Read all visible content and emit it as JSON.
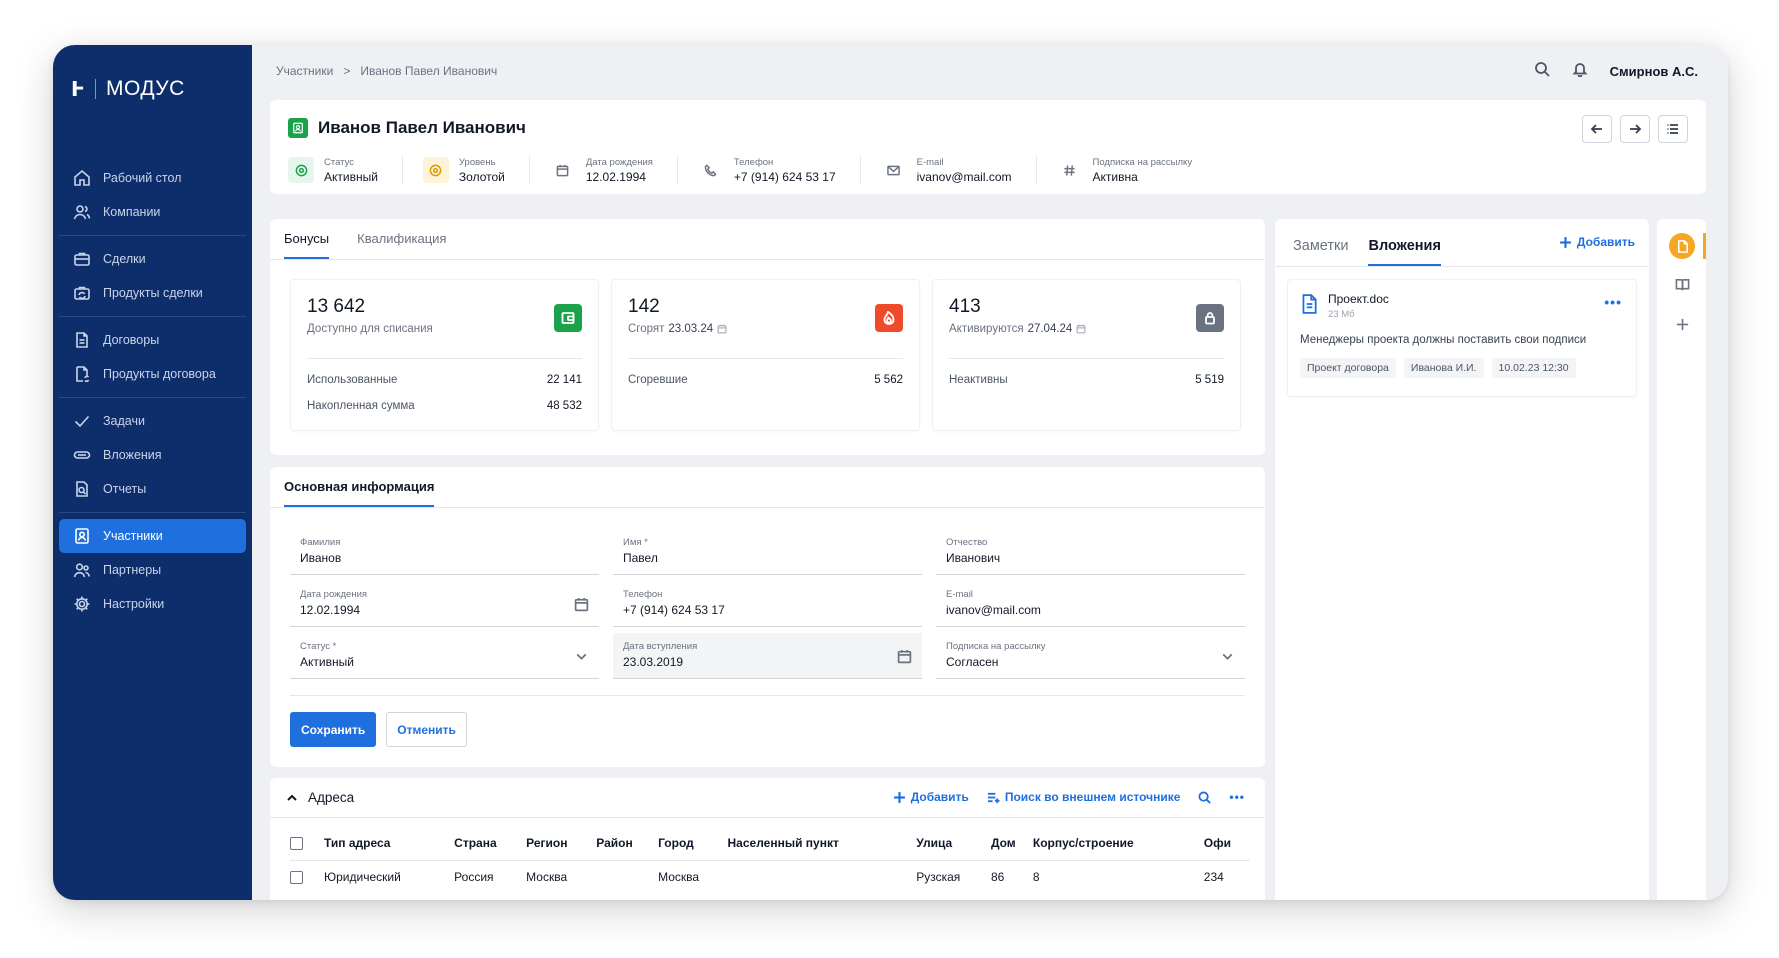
{
  "app": {
    "logo_mark": "Ⱶ",
    "name": "МОДУС"
  },
  "sidebar": {
    "groups": [
      [
        {
          "label": "Рабочий стол",
          "icon": "home-icon"
        },
        {
          "label": "Компании",
          "icon": "users-icon"
        }
      ],
      [
        {
          "label": "Сделки",
          "icon": "briefcase-icon"
        },
        {
          "label": "Продукты сделки",
          "icon": "briefcase-sync-icon"
        }
      ],
      [
        {
          "label": "Договоры",
          "icon": "document-icon"
        },
        {
          "label": "Продукты договора",
          "icon": "document-sync-icon"
        }
      ],
      [
        {
          "label": "Задачи",
          "icon": "check-icon"
        },
        {
          "label": "Вложения",
          "icon": "paperclip-icon"
        },
        {
          "label": "Отчеты",
          "icon": "report-icon"
        }
      ],
      [
        {
          "label": "Участники",
          "icon": "contact-badge-icon",
          "active": true
        },
        {
          "label": "Партнеры",
          "icon": "partners-icon"
        },
        {
          "label": "Настройки",
          "icon": "gear-icon"
        }
      ]
    ]
  },
  "topbar": {
    "breadcrumb": [
      "Участники",
      "Иванов Павел Иванович"
    ],
    "breadcrumb_sep": ">",
    "user": "Смирнов А.С."
  },
  "person": {
    "name": "Иванов Павел Иванович",
    "meta": [
      {
        "label": "Статус",
        "value": "Активный",
        "icon": "status-icon",
        "bg": "#e7f6ec",
        "color": "#1aa34a"
      },
      {
        "label": "Уровень",
        "value": "Золотой",
        "icon": "level-icon",
        "bg": "#fdf3d6",
        "color": "#d99a00"
      },
      {
        "label": "Дата рождения",
        "value": "12.02.1994",
        "icon": "calendar-icon",
        "bg": "#ffffff",
        "color": "#6b7280"
      },
      {
        "label": "Телефон",
        "value": "+7 (914) 624 53 17",
        "icon": "phone-icon",
        "bg": "#ffffff",
        "color": "#6b7280"
      },
      {
        "label": "E-mail",
        "value": "ivanov@mail.com",
        "icon": "mail-icon",
        "bg": "#ffffff",
        "color": "#6b7280"
      },
      {
        "label": "Подписка на рассылку",
        "value": "Активна",
        "icon": "hash-icon",
        "bg": "#ffffff",
        "color": "#6b7280"
      }
    ]
  },
  "bonus_tabs": [
    "Бонусы",
    "Квалификация"
  ],
  "bonuses": [
    {
      "number": "13 642",
      "sub": "Доступно для списания",
      "date": "",
      "icon": "wallet-icon",
      "color": "#1aa34a",
      "rows": [
        {
          "label": "Использованные",
          "value": "22 141"
        },
        {
          "label": "Накопленная сумма",
          "value": "48 532"
        }
      ]
    },
    {
      "number": "142",
      "sub": "Сгорят",
      "date": "23.03.24",
      "icon": "flame-icon",
      "color": "#ef4a2a",
      "rows": [
        {
          "label": "Сгоревшие",
          "value": "5 562"
        }
      ]
    },
    {
      "number": "413",
      "sub": "Активируются",
      "date": "27.04.24",
      "icon": "lock-icon",
      "color": "#6b7280",
      "rows": [
        {
          "label": "Неактивны",
          "value": "5 519"
        }
      ]
    }
  ],
  "info": {
    "tab": "Основная информация",
    "fields": [
      {
        "label": "Фамилия",
        "value": "Иванов",
        "icon": ""
      },
      {
        "label": "Имя *",
        "value": "Павел",
        "icon": ""
      },
      {
        "label": "Отчество",
        "value": "Иванович",
        "icon": ""
      },
      {
        "label": "Дата рождения",
        "value": "12.02.1994",
        "icon": "calendar"
      },
      {
        "label": "Телефон",
        "value": "+7 (914) 624 53 17",
        "icon": ""
      },
      {
        "label": "E-mail",
        "value": "ivanov@mail.com",
        "icon": ""
      },
      {
        "label": "Статус *",
        "value": "Активный",
        "icon": "chevron"
      },
      {
        "label": "Дата вступления",
        "value": "23.03.2019",
        "icon": "calendar",
        "filled": true
      },
      {
        "label": "Подписка на рассылку",
        "value": "Согласен",
        "icon": "chevron"
      }
    ],
    "save": "Сохранить",
    "cancel": "Отменить"
  },
  "addresses": {
    "title": "Адреса",
    "add": "Добавить",
    "search_external": "Поиск во внешнем источнике",
    "columns": [
      "Тип адреса",
      "Страна",
      "Регион",
      "Район",
      "Город",
      "Населенный пункт",
      "Улица",
      "Дом",
      "Корпус/строение",
      "Офи"
    ],
    "rows": [
      [
        "Юридический",
        "Россия",
        "Москва",
        "",
        "Москва",
        "",
        "Рузская",
        "86",
        "8",
        "234"
      ]
    ]
  },
  "side": {
    "tabs": [
      "Заметки",
      "Вложения"
    ],
    "add": "Добавить",
    "attachment": {
      "name": "Проект.doc",
      "size": "23 Мб",
      "desc": "Менеджеры проекта должны поставить свои подписи",
      "tags": [
        "Проект договора",
        "Иванова И.И.",
        "10.02.23 12:30"
      ]
    }
  },
  "rail": [
    "document-icon",
    "book-icon",
    "plus-icon"
  ],
  "colors": {
    "accent": "#1f6fde",
    "sidebar": "#0e2e6b",
    "warning": "#f5a623"
  }
}
